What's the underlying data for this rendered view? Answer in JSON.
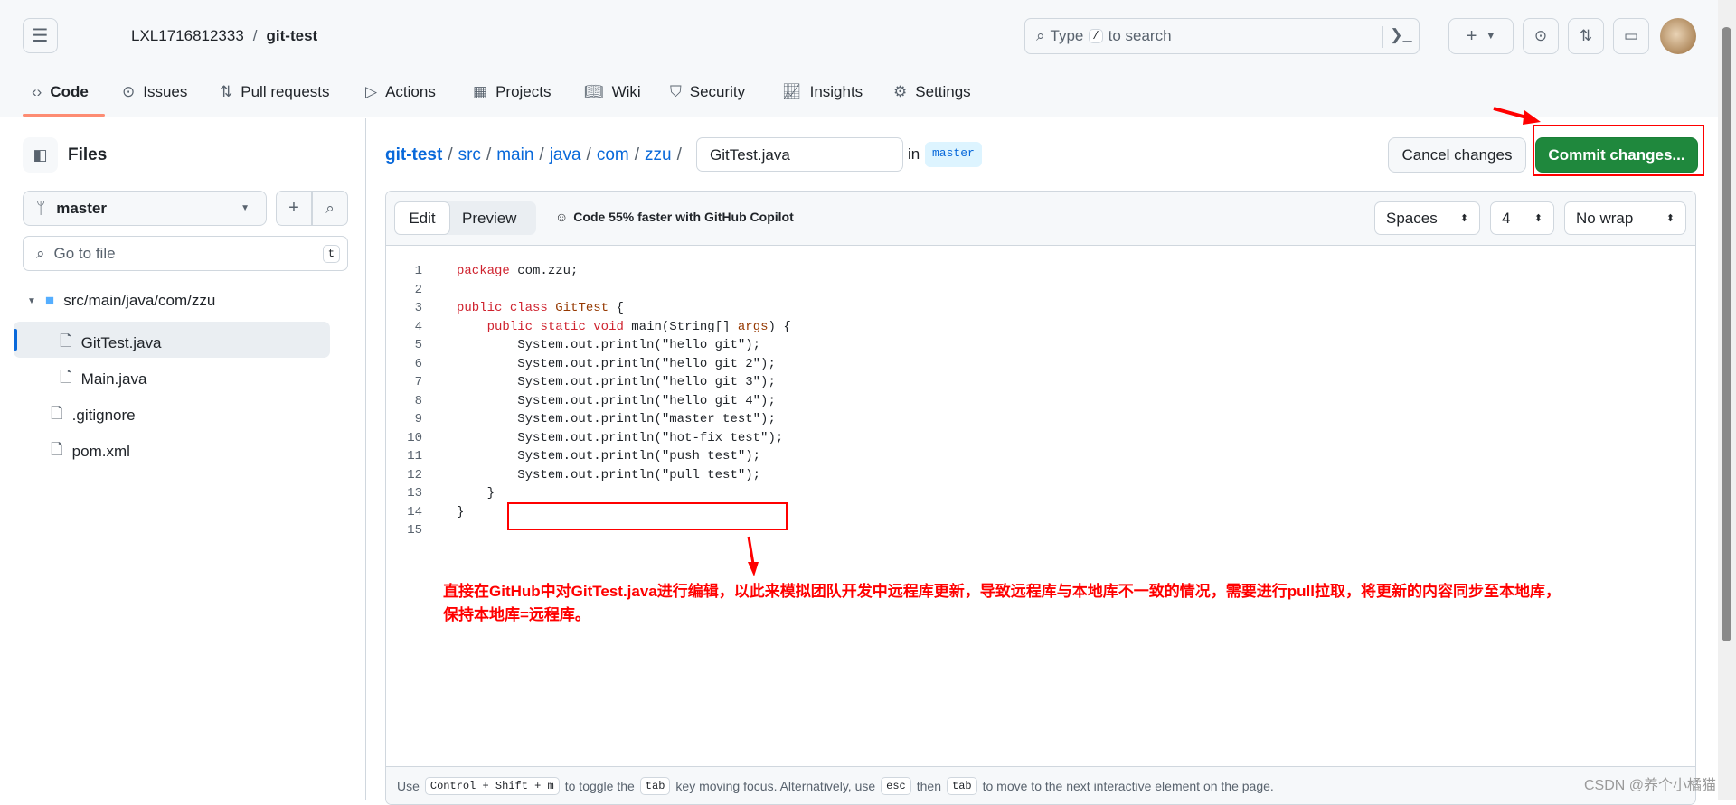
{
  "header": {
    "owner": "LXL1716812333",
    "separator": "/",
    "repo": "git-test",
    "search_placeholder_pre": "Type",
    "search_key": "/",
    "search_placeholder_post": "to search"
  },
  "nav": {
    "tabs": [
      {
        "label": "Code",
        "icon": "code-icon",
        "active": true
      },
      {
        "label": "Issues",
        "icon": "issue-icon"
      },
      {
        "label": "Pull requests",
        "icon": "pull-request-icon"
      },
      {
        "label": "Actions",
        "icon": "play-icon"
      },
      {
        "label": "Projects",
        "icon": "table-icon"
      },
      {
        "label": "Wiki",
        "icon": "book-icon"
      },
      {
        "label": "Security",
        "icon": "shield-icon"
      },
      {
        "label": "Insights",
        "icon": "graph-icon"
      },
      {
        "label": "Settings",
        "icon": "gear-icon"
      }
    ]
  },
  "sidebar": {
    "title": "Files",
    "branch": "master",
    "goto_placeholder": "Go to file",
    "goto_key": "t",
    "tree": [
      {
        "label": "src/main/java/com/zzu",
        "type": "folder"
      },
      {
        "label": "GitTest.java",
        "type": "file",
        "selected": true
      },
      {
        "label": "Main.java",
        "type": "file"
      },
      {
        "label": ".gitignore",
        "type": "file"
      },
      {
        "label": "pom.xml",
        "type": "file"
      }
    ]
  },
  "breadcrumb": {
    "parts": [
      "git-test",
      "src",
      "main",
      "java",
      "com",
      "zzu"
    ],
    "filename": "GitTest.java",
    "in": "in",
    "branch": "master"
  },
  "actions": {
    "cancel": "Cancel changes",
    "commit": "Commit changes..."
  },
  "editor": {
    "edit_tab": "Edit",
    "preview_tab": "Preview",
    "copilot": "Code 55% faster with GitHub Copilot",
    "indent_mode": "Spaces",
    "indent_size": "4",
    "wrap": "No wrap",
    "lines": [
      "package com.zzu;",
      "",
      "public class GitTest {",
      "    public static void main(String[] args) {",
      "        System.out.println(\"hello git\");",
      "        System.out.println(\"hello git 2\");",
      "        System.out.println(\"hello git 3\");",
      "        System.out.println(\"hello git 4\");",
      "        System.out.println(\"master test\");",
      "        System.out.println(\"hot-fix test\");",
      "        System.out.println(\"push test\");",
      "        System.out.println(\"pull test\");",
      "    }",
      "}",
      ""
    ]
  },
  "footer": {
    "t1": "Use",
    "k1": "Control + Shift + m",
    "t2": "to toggle the",
    "k2": "tab",
    "t3": "key moving focus. Alternatively, use",
    "k3": "esc",
    "t4": "then",
    "k4": "tab",
    "t5": "to move to the next interactive element on the page."
  },
  "annotation": {
    "line1": "直接在GitHub中对GitTest.java进行编辑，以此来模拟团队开发中远程库更新，导致远程库与本地库不一致的情况，需要进行pull拉取，将更新的内容同步至本地库，",
    "line2": "保持本地库=远程库。"
  },
  "watermark": "CSDN @养个小橘猫",
  "colors": {
    "accent": "#0969da",
    "commit": "#1f883d",
    "annotation": "#ff0000",
    "active_tab_underline": "#fd8c73"
  }
}
